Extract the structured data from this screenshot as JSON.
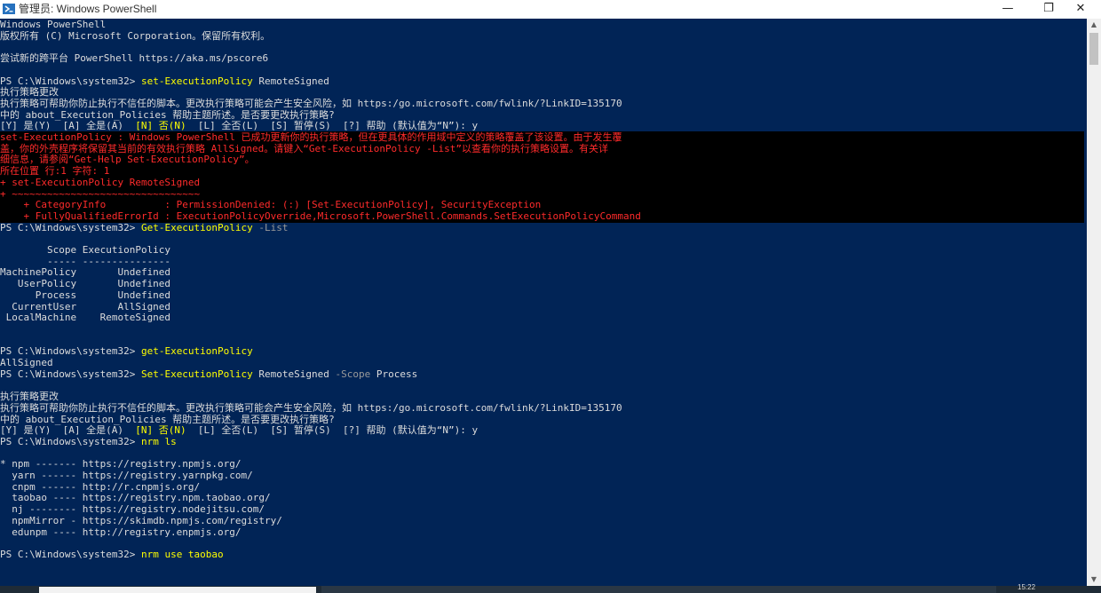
{
  "window": {
    "title": "管理员: Windows PowerShell",
    "minimize_glyph": "—",
    "maximize_glyph": "❐",
    "close_glyph": "✕",
    "icon": "powershell-icon"
  },
  "console": {
    "background": "#012456",
    "lines": [
      {
        "row": 0,
        "segs": [
          {
            "t": "Windows PowerShell",
            "c": "w"
          }
        ]
      },
      {
        "row": 1,
        "segs": [
          {
            "t": "版权所有 (C) Microsoft Corporation。保留所有权利。",
            "c": "w"
          }
        ]
      },
      {
        "row": 3,
        "segs": [
          {
            "t": "尝试新的跨平台 PowerShell https://aka.ms/pscore6",
            "c": "w"
          }
        ]
      },
      {
        "row": 5,
        "segs": [
          {
            "t": "PS C:\\Windows\\system32> ",
            "c": "w"
          },
          {
            "t": "set-ExecutionPolicy",
            "c": "y"
          },
          {
            "t": " RemoteSigned",
            "c": "w"
          }
        ]
      },
      {
        "row": 6,
        "segs": [
          {
            "t": "执行策略更改",
            "c": "w"
          }
        ]
      },
      {
        "row": 7,
        "segs": [
          {
            "t": "执行策略可帮助你防止执行不信任的脚本。更改执行策略可能会产生安全风险，如 https:/go.microsoft.com/fwlink/?LinkID=135170",
            "c": "w"
          }
        ]
      },
      {
        "row": 8,
        "segs": [
          {
            "t": "中的 about_Execution_Policies 帮助主题所述。是否要更改执行策略?",
            "c": "w"
          }
        ]
      },
      {
        "row": 9,
        "segs": [
          {
            "t": "[Y] 是(Y)  [A] 全是(A)  ",
            "c": "w"
          },
          {
            "t": "[N] 否(N)",
            "c": "y"
          },
          {
            "t": "  [L] 全否(L)  [S] 暂停(S)  [?] 帮助 (默认值为“N”): y",
            "c": "w"
          }
        ]
      },
      {
        "row": 10,
        "segs": [
          {
            "t": "set-ExecutionPolicy : Windows PowerShell 已成功更新你的执行策略，但在更具体的作用域中定义的策略覆盖了该设置。由于发生覆",
            "c": "r"
          }
        ]
      },
      {
        "row": 11,
        "segs": [
          {
            "t": "盖，你的外壳程序将保留其当前的有效执行策略 AllSigned。请键入“Get-ExecutionPolicy -List”以查看你的执行策略设置。有关详",
            "c": "r"
          }
        ]
      },
      {
        "row": 12,
        "segs": [
          {
            "t": "细信息，请参阅“Get-Help Set-ExecutionPolicy”。",
            "c": "r"
          }
        ]
      },
      {
        "row": 13,
        "segs": [
          {
            "t": "所在位置 行:1 字符: 1",
            "c": "r"
          }
        ]
      },
      {
        "row": 14,
        "segs": [
          {
            "t": "+ set-ExecutionPolicy RemoteSigned",
            "c": "r"
          }
        ]
      },
      {
        "row": 15,
        "segs": [
          {
            "t": "+ ~~~~~~~~~~~~~~~~~~~~~~~~~~~~~~~~",
            "c": "r"
          }
        ]
      },
      {
        "row": 16,
        "segs": [
          {
            "t": "    + CategoryInfo          : PermissionDenied: (:) [Set-ExecutionPolicy], SecurityException",
            "c": "r"
          }
        ]
      },
      {
        "row": 17,
        "segs": [
          {
            "t": "    + FullyQualifiedErrorId : ExecutionPolicyOverride,Microsoft.PowerShell.Commands.SetExecutionPolicyCommand",
            "c": "r"
          }
        ]
      },
      {
        "row": 18,
        "segs": [
          {
            "t": "PS C:\\Windows\\system32> ",
            "c": "w"
          },
          {
            "t": "Get-ExecutionPolicy",
            "c": "y"
          },
          {
            "t": " -List",
            "c": "g"
          }
        ]
      },
      {
        "row": 20,
        "segs": [
          {
            "t": "        Scope ExecutionPolicy",
            "c": "w"
          }
        ]
      },
      {
        "row": 21,
        "segs": [
          {
            "t": "        ----- ---------------",
            "c": "w"
          }
        ]
      },
      {
        "row": 22,
        "segs": [
          {
            "t": "MachinePolicy       Undefined",
            "c": "w"
          }
        ]
      },
      {
        "row": 23,
        "segs": [
          {
            "t": "   UserPolicy       Undefined",
            "c": "w"
          }
        ]
      },
      {
        "row": 24,
        "segs": [
          {
            "t": "      Process       Undefined",
            "c": "w"
          }
        ]
      },
      {
        "row": 25,
        "segs": [
          {
            "t": "  CurrentUser       AllSigned",
            "c": "w"
          }
        ]
      },
      {
        "row": 26,
        "segs": [
          {
            "t": " LocalMachine    RemoteSigned",
            "c": "w"
          }
        ]
      },
      {
        "row": 29,
        "segs": [
          {
            "t": "PS C:\\Windows\\system32> ",
            "c": "w"
          },
          {
            "t": "get-ExecutionPolicy",
            "c": "y"
          }
        ]
      },
      {
        "row": 30,
        "segs": [
          {
            "t": "AllSigned",
            "c": "w"
          }
        ]
      },
      {
        "row": 31,
        "segs": [
          {
            "t": "PS C:\\Windows\\system32> ",
            "c": "w"
          },
          {
            "t": "Set-ExecutionPolicy",
            "c": "y"
          },
          {
            "t": " RemoteSigned ",
            "c": "w"
          },
          {
            "t": "-Scope",
            "c": "g"
          },
          {
            "t": " Process",
            "c": "w"
          }
        ]
      },
      {
        "row": 33,
        "segs": [
          {
            "t": "执行策略更改",
            "c": "w"
          }
        ]
      },
      {
        "row": 34,
        "segs": [
          {
            "t": "执行策略可帮助你防止执行不信任的脚本。更改执行策略可能会产生安全风险，如 https:/go.microsoft.com/fwlink/?LinkID=135170",
            "c": "w"
          }
        ]
      },
      {
        "row": 35,
        "segs": [
          {
            "t": "中的 about_Execution_Policies 帮助主题所述。是否要更改执行策略?",
            "c": "w"
          }
        ]
      },
      {
        "row": 36,
        "segs": [
          {
            "t": "[Y] 是(Y)  [A] 全是(A)  ",
            "c": "w"
          },
          {
            "t": "[N] 否(N)",
            "c": "y"
          },
          {
            "t": "  [L] 全否(L)  [S] 暂停(S)  [?] 帮助 (默认值为“N”): y",
            "c": "w"
          }
        ]
      },
      {
        "row": 37,
        "segs": [
          {
            "t": "PS C:\\Windows\\system32> ",
            "c": "w"
          },
          {
            "t": "nrm ls",
            "c": "y"
          }
        ]
      },
      {
        "row": 39,
        "segs": [
          {
            "t": "* npm ------- https://registry.npmjs.org/",
            "c": "w"
          }
        ]
      },
      {
        "row": 40,
        "segs": [
          {
            "t": "  yarn ------ https://registry.yarnpkg.com/",
            "c": "w"
          }
        ]
      },
      {
        "row": 41,
        "segs": [
          {
            "t": "  cnpm ------ http://r.cnpmjs.org/",
            "c": "w"
          }
        ]
      },
      {
        "row": 42,
        "segs": [
          {
            "t": "  taobao ---- https://registry.npm.taobao.org/",
            "c": "w"
          }
        ]
      },
      {
        "row": 43,
        "segs": [
          {
            "t": "  nj -------- https://registry.nodejitsu.com/",
            "c": "w"
          }
        ]
      },
      {
        "row": 44,
        "segs": [
          {
            "t": "  npmMirror - https://skimdb.npmjs.com/registry/",
            "c": "w"
          }
        ]
      },
      {
        "row": 45,
        "segs": [
          {
            "t": "  edunpm ---- http://registry.enpmjs.org/",
            "c": "w"
          }
        ]
      },
      {
        "row": 47,
        "segs": [
          {
            "t": "PS C:\\Windows\\system32> ",
            "c": "w"
          },
          {
            "t": "nrm use taobao",
            "c": "y"
          }
        ]
      }
    ],
    "error_block": {
      "from_row": 10,
      "to_row": 17
    }
  },
  "taskbar": {
    "clock": "15:22"
  }
}
